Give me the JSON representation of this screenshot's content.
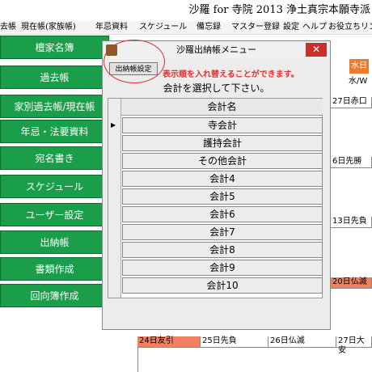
{
  "window": {
    "title": "沙羅 for 寺院 2013 浄土真宗本願寺派"
  },
  "menu": [
    "去帳",
    "現在帳(家族帳)",
    "年忌資料",
    "スケジュール",
    "備忘録",
    "マスター登録",
    "設定",
    "ヘルプ",
    "お役立ちリン"
  ],
  "sidebar": [
    "檀家名簿",
    "過去帳",
    "家別過去帳/現在帳",
    "年忌・法要資料",
    "宛名書き",
    "スケジュール",
    "ユーザー設定",
    "出納帳",
    "書類作成",
    "回向簿作成"
  ],
  "calendar": {
    "weekday_header": "水/W",
    "badge": "水日",
    "cells": [
      "27日赤口",
      "6日先勝",
      "13日先負",
      "20日仏滅",
      "24日友引",
      "25日先負",
      "26日仏滅",
      "27日大安"
    ]
  },
  "dialog": {
    "title": "沙羅出納帳メニュー",
    "settings_button": "出納帳設定",
    "note": "表示順を入れ替えることができます。",
    "instruction": "会計を選択して下さい。",
    "column_header": "会計名",
    "items": [
      "寺会計",
      "護持会計",
      "その他会計",
      "会計4",
      "会計5",
      "会計6",
      "会計7",
      "会計8",
      "会計9",
      "会計10"
    ],
    "selected_index": 0,
    "close_glyph": "✕"
  }
}
